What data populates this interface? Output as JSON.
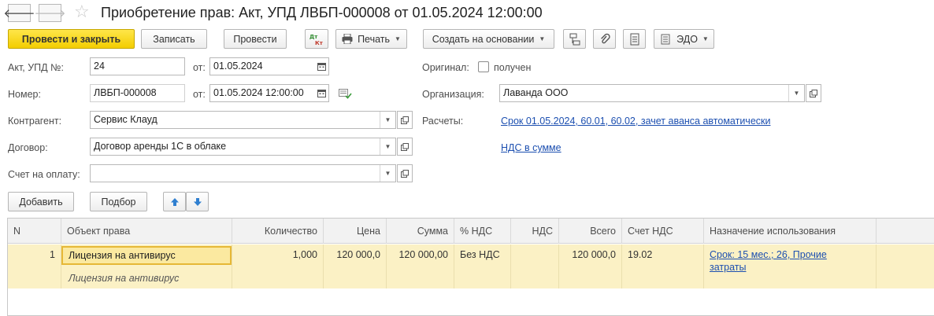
{
  "window": {
    "title": "Приобретение прав: Акт, УПД ЛВБП-000008 от 01.05.2024 12:00:00"
  },
  "toolbar": {
    "post_close": "Провести и закрыть",
    "save": "Записать",
    "post": "Провести",
    "print": "Печать",
    "create_based": "Создать на основании",
    "edo": "ЭДО"
  },
  "form": {
    "act_label": "Акт, УПД №:",
    "act_value": "24",
    "from_label": "от:",
    "act_date": "01.05.2024",
    "number_label": "Номер:",
    "number_value": "ЛВБП-000008",
    "number_from_label": "от:",
    "number_date": "01.05.2024 12:00:00",
    "contractor_label": "Контрагент:",
    "contractor_value": "Сервис Клауд",
    "contract_label": "Договор:",
    "contract_value": "Договор аренды 1С в облаке",
    "invoice_label": "Счет на оплату:",
    "invoice_value": "",
    "original_label": "Оригинал:",
    "original_check_label": "получен",
    "org_label": "Организация:",
    "org_value": "Лаванда ООО",
    "settlements_label": "Расчеты:",
    "settlements_link": "Срок 01.05.2024, 60.01, 60.02, зачет аванса автоматически",
    "vat_link": "НДС в сумме"
  },
  "table_toolbar": {
    "add": "Добавить",
    "pick": "Подбор"
  },
  "table": {
    "columns": [
      "N",
      "Объект права",
      "Количество",
      "Цена",
      "Сумма",
      "% НДС",
      "НДС",
      "Всего",
      "Счет НДС",
      "Назначение использования"
    ],
    "rows": [
      {
        "n": "1",
        "object": "Лицензия на антивирус",
        "object_sub": "Лицензия на антивирус",
        "qty": "1,000",
        "price": "120 000,0",
        "sum": "120 000,00",
        "vat_rate": "Без НДС",
        "vat": "",
        "total": "120 000,0",
        "vat_account": "19.02",
        "purpose_line1": "Срок: 15 мес.; 26, Прочие",
        "purpose_line2": "затраты"
      }
    ]
  },
  "icons": {
    "back": "arrow-left-icon",
    "forward": "arrow-right-icon",
    "favorite": "star-icon",
    "dtkt": "dt-kt-icon",
    "print": "printer-icon",
    "structure": "structure-icon",
    "attach": "paperclip-icon",
    "report": "report-icon",
    "edo": "edo-icon",
    "up": "arrow-up-icon",
    "down": "arrow-down-icon",
    "calendar": "calendar-icon",
    "history": "history-icon",
    "open": "open-icon"
  },
  "colors": {
    "primary_button": "#f3cd00",
    "row_highlight": "#fbf1c5",
    "link": "#1c4fb0"
  }
}
